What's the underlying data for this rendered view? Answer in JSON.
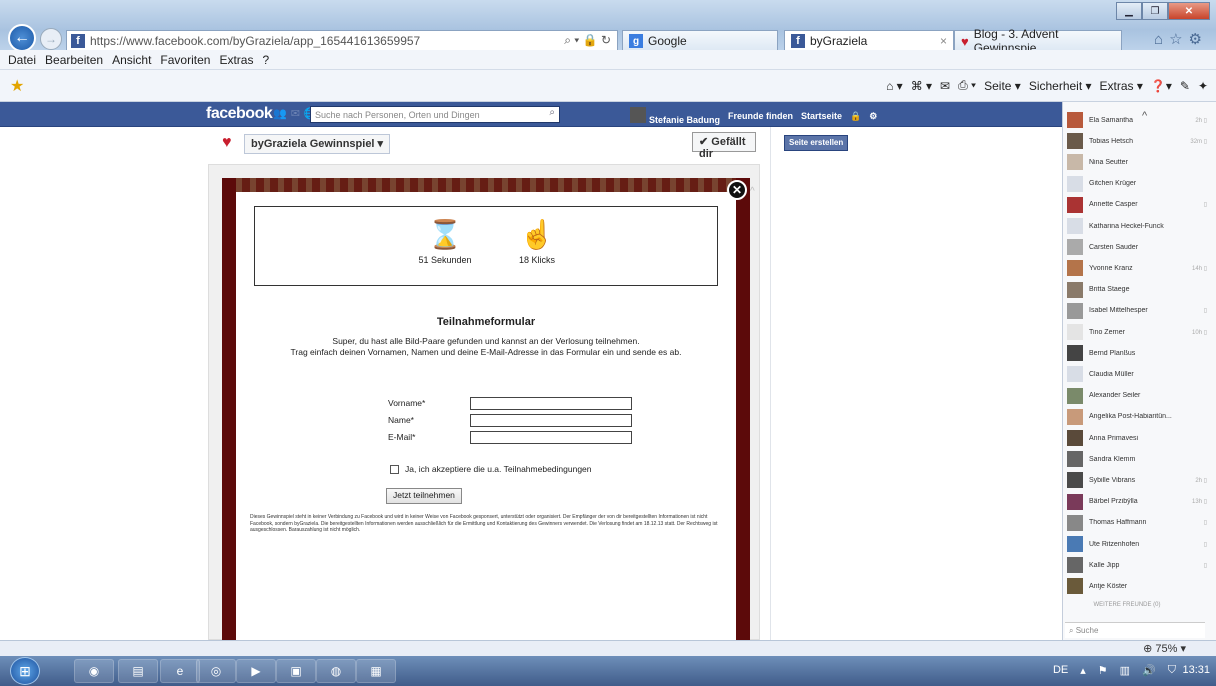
{
  "browser": {
    "url": "https://www.facebook.com/byGraziela/app_165441613659957",
    "address_tools": "⌕ ▾ 🔒 ↻",
    "tabs": [
      {
        "label": "Google"
      },
      {
        "label": "byGraziela"
      },
      {
        "label": "Blog - 3. Advent Gewinnspie..."
      }
    ],
    "menu": [
      "Datei",
      "Bearbeiten",
      "Ansicht",
      "Favoriten",
      "Extras",
      "?"
    ],
    "commands": {
      "page": "Seite ▾",
      "security": "Sicherheit ▾",
      "extras": "Extras ▾"
    },
    "zoom": "75%"
  },
  "facebook": {
    "logo": "facebook",
    "search_placeholder": "Suche nach Personen, Orten und Dingen",
    "user_name": "Stefanie Badung",
    "find_friends": "Freunde finden",
    "home": "Startseite",
    "app_title": "byGraziela  Gewinnspiel ▾",
    "like_button": "✔ Gefällt dir",
    "create_page": "Seite erstellen"
  },
  "game": {
    "seconds": "51 Sekunden",
    "clicks": "18 Klicks"
  },
  "form": {
    "title": "Teilnahmeformular",
    "intro_1": "Super, du hast alle Bild-Paare gefunden und kannst an der Verlosung teilnehmen.",
    "intro_2": "Trag einfach deinen Vornamen, Namen und deine E-Mail-Adresse in das Formular ein und sende es ab.",
    "firstname_label": "Vorname*",
    "name_label": "Name*",
    "email_label": "E-Mail*",
    "terms_label": "Ja, ich akzeptiere die u.a. Teilnahmebedingungen",
    "submit": "Jetzt teilnehmen",
    "disclaimer": "Dieses Gewinnspiel steht in keiner Verbindung zu Facebook und wird in keiner Weise von Facebook gesponsert, unterstützt oder organisiert. Der Empfänger der von dir bereitgestellten Informationen ist nicht Facebook, sondern byGraziela. Die bereitgestellten Informationen werden ausschließlich für die Ermittlung und Kontaktierung des Gewinners verwendet. Die Verlosung findet am 18.12.13 statt. Der Rechtsweg ist ausgeschlossen. Barauszahlung ist nicht möglich."
  },
  "chat": {
    "friends": [
      {
        "name": "Ela Samantha",
        "status": "2h ▯",
        "color": "#b85a3c"
      },
      {
        "name": "Tobias Hetsch",
        "status": "32m ▯",
        "color": "#6a5a4a"
      },
      {
        "name": "Nina Seutter",
        "status": "",
        "color": "#c8b8a8"
      },
      {
        "name": "Gitchen Krüger",
        "status": "",
        "color": "#d8dde6"
      },
      {
        "name": "Annette Casper",
        "status": "▯",
        "color": "#a33"
      },
      {
        "name": "Katharina Heckel-Funck",
        "status": "",
        "color": "#d8dde6"
      },
      {
        "name": "Carsten Sauder",
        "status": "",
        "color": "#aaa"
      },
      {
        "name": "Yvonne Kranz",
        "status": "14h ▯",
        "color": "#b4744a"
      },
      {
        "name": "Britta Staege",
        "status": "",
        "color": "#8a7a6a"
      },
      {
        "name": "Isabel Mittelhesper",
        "status": "▯",
        "color": "#999"
      },
      {
        "name": "Tino Zerner",
        "status": "10h ▯",
        "color": "#e4e4e4"
      },
      {
        "name": "Bernd Planßus",
        "status": "",
        "color": "#444"
      },
      {
        "name": "Claudia Müller",
        "status": "",
        "color": "#d8dde6"
      },
      {
        "name": "Alexander Seiler",
        "status": "",
        "color": "#7a8a6a"
      },
      {
        "name": "Angelika Post-Habiaritün...",
        "status": "",
        "color": "#c89a7a"
      },
      {
        "name": "Anna Primavesi",
        "status": "",
        "color": "#5a4a3a"
      },
      {
        "name": "Sandra Klemm",
        "status": "",
        "color": "#666"
      },
      {
        "name": "Sybille Vibrans",
        "status": "2h ▯",
        "color": "#4a4a4a"
      },
      {
        "name": "Bärbel Prziby̆lla",
        "status": "13h ▯",
        "color": "#7a3a5a"
      },
      {
        "name": "Thomas Haffmann",
        "status": "▯",
        "color": "#888"
      },
      {
        "name": "Ute Ritzenhofen",
        "status": "▯",
        "color": "#4a7ab4"
      },
      {
        "name": "Kalle Jipp",
        "status": "▯",
        "color": "#666"
      },
      {
        "name": "Antje Köster",
        "status": "",
        "color": "#6a5a3a"
      }
    ],
    "more_friends": "WEITERE FREUNDE (0)",
    "search_placeholder": "Suche"
  },
  "taskbar": {
    "language": "DE",
    "time": "13:31"
  }
}
